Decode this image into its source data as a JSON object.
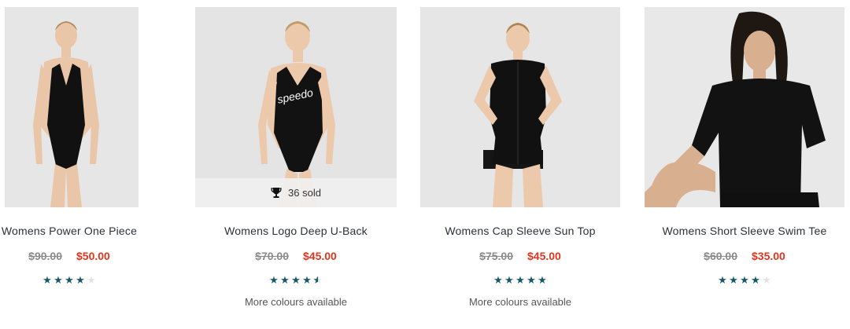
{
  "products": [
    {
      "title": "Womens Power One Piece",
      "was_price": "$90.00",
      "now_price": "$50.00",
      "rating": 4,
      "rating_max": 5
    },
    {
      "title": "Womens Logo Deep U-Back",
      "was_price": "$70.00",
      "now_price": "$45.00",
      "rating": 4.5,
      "rating_max": 5,
      "sold_label": "36 sold",
      "sold_icon": "trophy-icon",
      "more_text": "More colours available"
    },
    {
      "title": "Womens Cap Sleeve Sun Top",
      "was_price": "$75.00",
      "now_price": "$45.00",
      "rating": 5,
      "rating_max": 5,
      "more_text": "More colours available"
    },
    {
      "title": "Womens Short Sleeve Swim Tee",
      "was_price": "$60.00",
      "now_price": "$35.00",
      "rating": 4,
      "rating_max": 5
    }
  ],
  "colors": {
    "sale_price": "#e0351e",
    "was_price": "#8a8a8a",
    "star_filled": "#145a66",
    "star_empty": "#e3e3e3",
    "photo_background": "#e6e6e6"
  }
}
